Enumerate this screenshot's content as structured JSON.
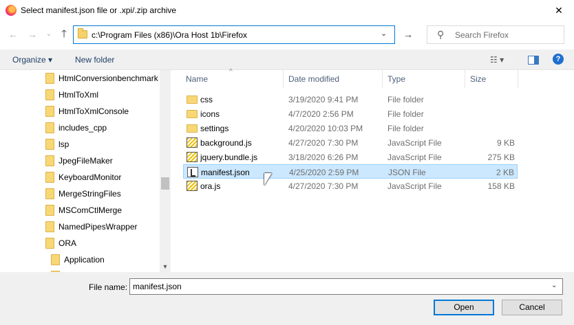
{
  "window": {
    "title": "Select manifest.json file or .xpi/.zip archive",
    "close_glyph": "✕",
    "app_icon": "firefox-icon"
  },
  "nav": {
    "back_glyph": "←",
    "forward_glyph": "→",
    "recent_glyph": "⌄",
    "up_glyph": "🡑",
    "address": "c:\\Program Files (x86)\\Ora Host 1b\\Firefox",
    "address_chevron": "⌄",
    "refresh_glyph": "→",
    "search_placeholder": "Search Firefox",
    "search_glyph": "⚲"
  },
  "commandbar": {
    "organize": "Organize ▾",
    "new_folder": "New folder",
    "views_glyph": "☷ ▾",
    "help_glyph": "?"
  },
  "tree": {
    "items": [
      {
        "label": "HtmlConversionbenchmark"
      },
      {
        "label": "HtmlToXml"
      },
      {
        "label": "HtmlToXmlConsole"
      },
      {
        "label": "includes_cpp"
      },
      {
        "label": "lsp"
      },
      {
        "label": "JpegFileMaker"
      },
      {
        "label": "KeyboardMonitor"
      },
      {
        "label": "MergeStringFiles"
      },
      {
        "label": "MSComCtlMerge"
      },
      {
        "label": "NamedPipesWrapper"
      },
      {
        "label": "ORA"
      },
      {
        "label": "Application"
      }
    ],
    "scroll_down_glyph": "▼"
  },
  "columns": {
    "name": "Name",
    "date": "Date modified",
    "type": "Type",
    "size": "Size",
    "sort_glyph": "^"
  },
  "files": [
    {
      "name": "css",
      "date": "3/19/2020 9:41 PM",
      "type": "File folder",
      "size": "",
      "icon": "folder-icon"
    },
    {
      "name": "icons",
      "date": "4/7/2020 2:56 PM",
      "type": "File folder",
      "size": "",
      "icon": "folder-icon"
    },
    {
      "name": "settings",
      "date": "4/20/2020 10:03 PM",
      "type": "File folder",
      "size": "",
      "icon": "folder-icon"
    },
    {
      "name": "background.js",
      "date": "4/27/2020 7:30 PM",
      "type": "JavaScript File",
      "size": "9 KB",
      "icon": "js-file-icon"
    },
    {
      "name": "jquery.bundle.js",
      "date": "3/18/2020 6:26 PM",
      "type": "JavaScript File",
      "size": "275 KB",
      "icon": "js-file-icon"
    },
    {
      "name": "manifest.json",
      "date": "4/25/2020 2:59 PM",
      "type": "JSON File",
      "size": "2 KB",
      "icon": "json-file-icon",
      "selected": true
    },
    {
      "name": "ora.js",
      "date": "4/27/2020 7:30 PM",
      "type": "JavaScript File",
      "size": "158 KB",
      "icon": "js-file-icon"
    }
  ],
  "footer": {
    "filename_label": "File name:",
    "filename_value": "manifest.json",
    "filename_chevron": "⌄",
    "open_label": "Open",
    "cancel_label": "Cancel"
  }
}
